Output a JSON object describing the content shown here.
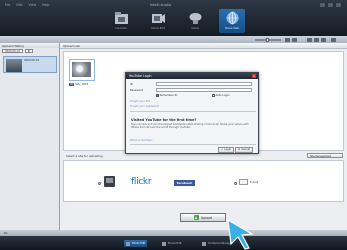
{
  "app": {
    "title": "Intelli-studio",
    "menu": [
      "File",
      "Edit",
      "View",
      "Help"
    ]
  },
  "modes": [
    {
      "label": "Contents"
    },
    {
      "label": "Movie Edit"
    },
    {
      "label": "Share"
    },
    {
      "label": "Share Web"
    }
  ],
  "left_panel": {
    "header": "Upload History",
    "selectors": [
      "2009.06.19",
      "▼"
    ],
    "item_title": "2009.06.19"
  },
  "main": {
    "header": "Upload List",
    "thumb_label": "SAV_0003",
    "hd_badge": "HD"
  },
  "dialog": {
    "title": "YouTube Login",
    "id_label": "ID",
    "password_label": "Password",
    "remember_id": "Remember ID",
    "auto_login": "Auto Login",
    "forgot_id": "Forgot your ID?",
    "forgot_password": "Forgot your password?",
    "first_time_heading": "Visited YouTube for the first time?",
    "first_time_text": "Sign up here and join the largest worldwide video-sharing community! Share your videos with others from all over the world through YouTube.",
    "signup_link": "What is YouTube?",
    "login_btn": "Login",
    "cancel_btn": "Cancel"
  },
  "sites": {
    "label": "Select a site for uploading",
    "management": "Site Management",
    "email_label": "E-mail",
    "flickr_a": "flickr",
    "flickr_b": "",
    "facebook": "facebook"
  },
  "upload": {
    "label": "Upload"
  },
  "footer": {
    "strip_label": "PC",
    "tabs": [
      "Photo Edit",
      "Movie Edit",
      "Contents Manager"
    ]
  }
}
